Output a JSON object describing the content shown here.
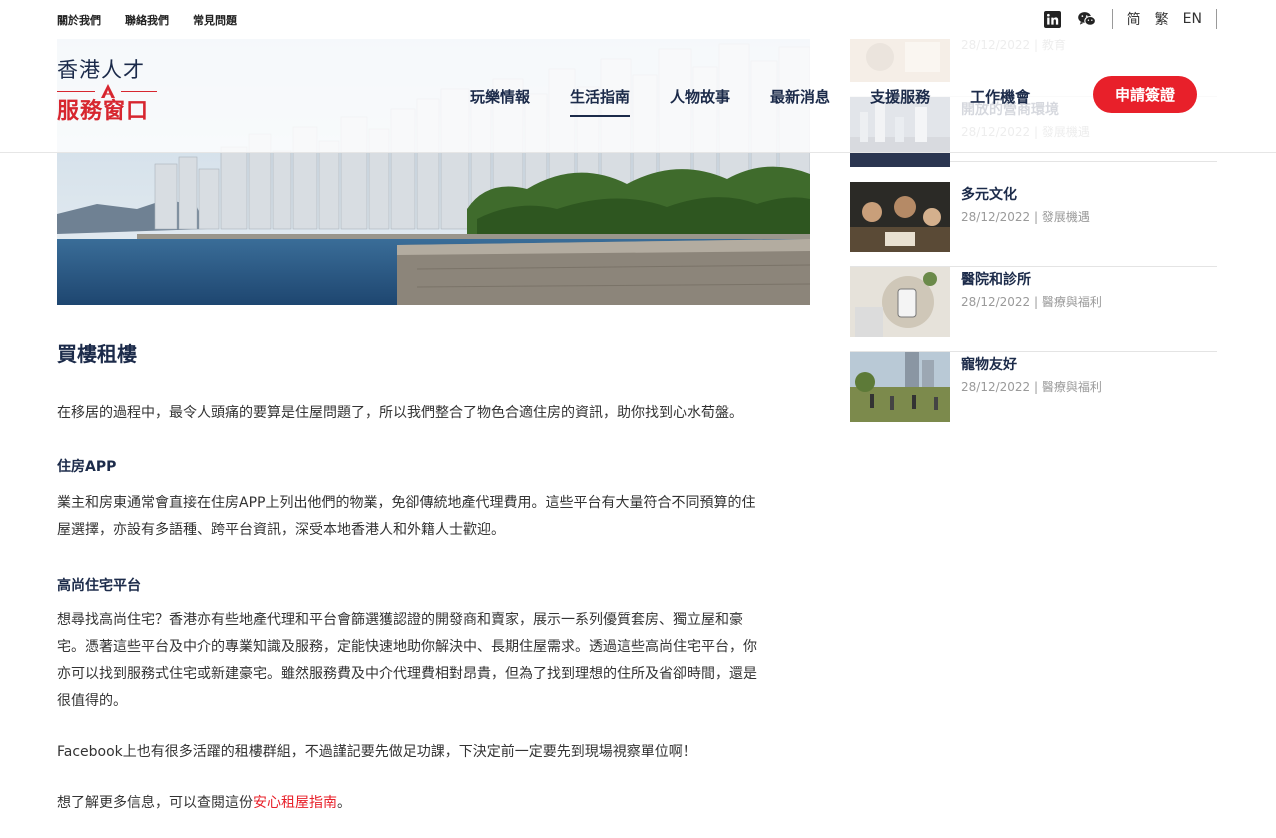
{
  "topbar": {
    "links": [
      "關於我們",
      "聯絡我們",
      "常見問題"
    ],
    "social_icons": [
      "linkedin-icon",
      "wechat-icon"
    ],
    "languages": [
      "简",
      "繁",
      "EN"
    ]
  },
  "logo": {
    "line1": "香港人才",
    "line2": "服務窗口"
  },
  "nav": {
    "items": [
      "玩樂情報",
      "生活指南",
      "人物故事",
      "最新消息",
      "支援服務",
      "工作機會"
    ],
    "active": "生活指南",
    "apply_label": "申請簽證"
  },
  "colors": {
    "brand_red": "#e8202a",
    "navy": "#1c2b4a"
  },
  "article": {
    "title": "買樓租樓",
    "intro": "在移居的過程中，最令人頭痛的要算是住屋問題了，所以我們整合了物色合適住房的資訊，助你找到心水荀盤。",
    "sections": [
      {
        "heading": "住房APP",
        "lines": [
          "業主和房東通常會直接在住房APP上列出他們的物業，免卻傳統地產代理費用。這些平台有大量符合不同預算的住",
          "屋選擇，亦設有多語種、跨平台資訊，深受本地香港人和外籍人士歡迎。"
        ]
      },
      {
        "heading": "高尚住宅平台",
        "lines": [
          "想尋找高尚住宅？香港亦有些地產代理和平台會篩選獲認證的開發商和賣家，展示一系列優質套房、獨立屋和豪",
          "宅。憑著這些平台及中介的專業知識及服務，定能快速地助你解決中、長期住屋需求。透過這些高尚住宅平台，你",
          "亦可以找到服務式住宅或新建豪宅。雖然服務費及中介代理費相對昂貴，但為了找到理想的住所及省卻時間，還是",
          "很值得的。"
        ]
      }
    ],
    "facebook_note": "Facebook上也有很多活躍的租樓群組，不過謹記要先做足功課，下決定前一定要先到現場視察單位啊！",
    "more_prefix": "想了解更多信息，可以查閱這份",
    "more_link": "安心租屋指南",
    "more_suffix": "。"
  },
  "sidebar": {
    "items": [
      {
        "title": "",
        "date": "28/12/2022",
        "category": "教育"
      },
      {
        "title": "開放的營商環境",
        "date": "28/12/2022",
        "category": "發展機遇"
      },
      {
        "title": "多元文化",
        "date": "28/12/2022",
        "category": "發展機遇"
      },
      {
        "title": "醫院和診所",
        "date": "28/12/2022",
        "category": "醫療與福利"
      },
      {
        "title": "寵物友好",
        "date": "28/12/2022",
        "category": "醫療與福利"
      }
    ]
  }
}
